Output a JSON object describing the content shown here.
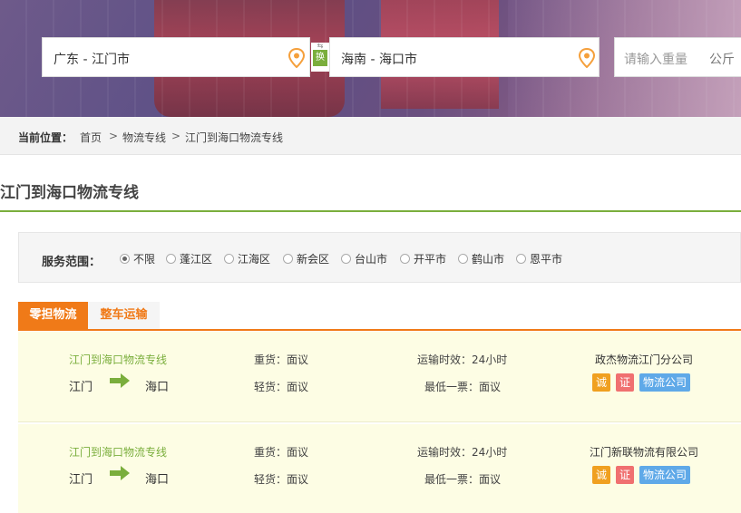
{
  "search": {
    "from_value": "广东 - 江门市",
    "to_value": "海南 - 海口市",
    "swap_label": "换",
    "weight_placeholder": "请输入重量",
    "weight_unit": "公斤"
  },
  "breadcrumb": {
    "label": "当前位置：",
    "items": [
      "首页",
      "物流专线",
      "江门到海口物流专线"
    ],
    "separator": ">"
  },
  "page_title": "江门到海口物流专线",
  "filter": {
    "label": "服务范围：",
    "options": [
      {
        "label": "不限",
        "selected": true
      },
      {
        "label": "蓬江区",
        "selected": false
      },
      {
        "label": "江海区",
        "selected": false
      },
      {
        "label": "新会区",
        "selected": false
      },
      {
        "label": "台山市",
        "selected": false
      },
      {
        "label": "开平市",
        "selected": false
      },
      {
        "label": "鹤山市",
        "selected": false
      },
      {
        "label": "恩平市",
        "selected": false
      }
    ]
  },
  "tabs": [
    {
      "label": "零担物流",
      "active": true
    },
    {
      "label": "整车运输",
      "active": false
    }
  ],
  "listings": [
    {
      "route": "江门到海口物流专线",
      "from": "江门",
      "to": "海口",
      "heavy": "重货：面议",
      "light": "轻货：面议",
      "time": "运输时效：24小时",
      "min": "最低一票：面议",
      "company": "政杰物流江门分公司",
      "badges": [
        "诚",
        "证",
        "物流公司"
      ]
    },
    {
      "route": "江门到海口物流专线",
      "from": "江门",
      "to": "海口",
      "heavy": "重货：面议",
      "light": "轻货：面议",
      "time": "运输时效：24小时",
      "min": "最低一票：面议",
      "company": "江门新联物流有限公司",
      "badges": [
        "诚",
        "证",
        "物流公司"
      ]
    }
  ],
  "colors": {
    "accent_green": "#7aae3c",
    "tab_orange": "#f07a18",
    "pin_orange": "#f5a03c",
    "badge_cheng": "#f0a020",
    "badge_zheng": "#f07070",
    "badge_company": "#5fa9e8"
  },
  "icons": {
    "pin": "location-pin-icon",
    "swap": "swap-icon",
    "arrow": "right-arrow-icon"
  }
}
